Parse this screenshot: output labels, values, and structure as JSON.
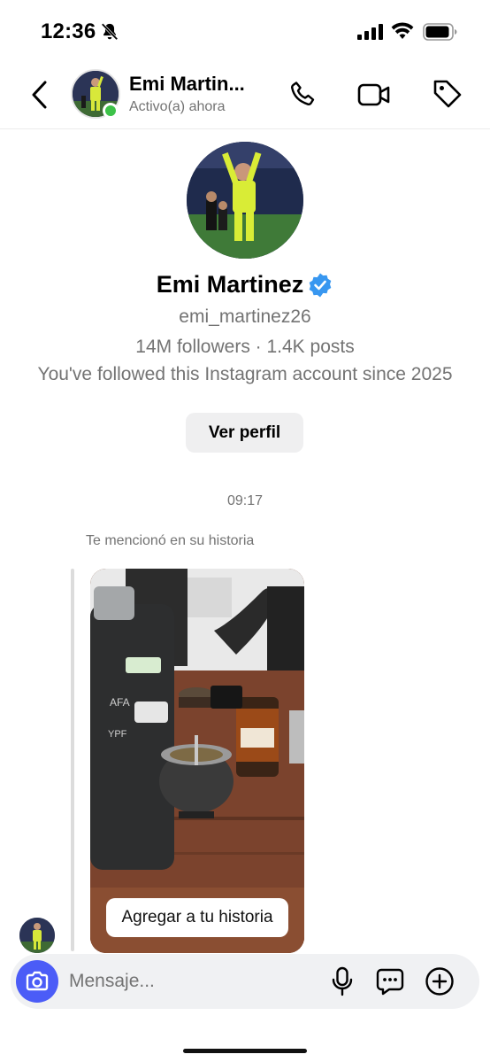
{
  "status_bar": {
    "time": "12:36",
    "icons": [
      "bell-slash-icon",
      "signal-icon",
      "wifi-icon",
      "battery-icon"
    ]
  },
  "header": {
    "name": "Emi Martin...",
    "status": "Activo(a) ahora",
    "icons": [
      "back-icon",
      "phone-icon",
      "video-icon",
      "tag-icon"
    ],
    "online_color": "#3dc249"
  },
  "profile": {
    "name": "Emi Martinez",
    "verified": true,
    "username": "emi_martinez26",
    "stats": "14M followers · 1.4K posts",
    "since": "You've followed this Instagram account since 2025",
    "view_profile_label": "Ver perfil"
  },
  "conversation": {
    "time": "09:17",
    "mention_label": "Te mencionó en su historia",
    "add_story_label": "Agregar a tu historia"
  },
  "composer": {
    "placeholder": "Mensaje...",
    "icons": [
      "camera-icon",
      "mic-icon",
      "sticker-icon",
      "plus-icon"
    ],
    "camera_color": "#4b5cf7"
  },
  "colors": {
    "verified_blue": "#3897f0",
    "secondary_text": "#737373"
  }
}
